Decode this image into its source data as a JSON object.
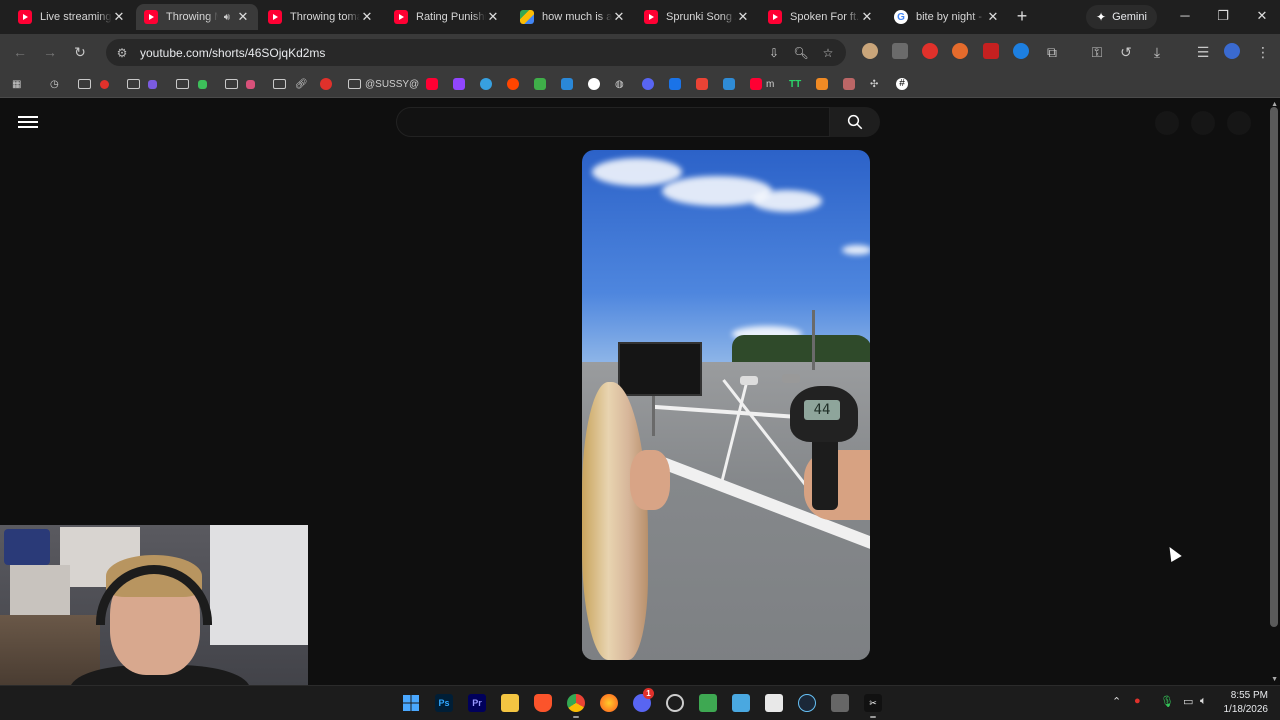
{
  "tabs": [
    {
      "title": "Live streaming",
      "icon": "youtube-icon",
      "active": false
    },
    {
      "title": "Throwing M",
      "icon": "youtube-icon",
      "active": true
    },
    {
      "title": "Throwing toma",
      "icon": "youtube-icon",
      "active": false
    },
    {
      "title": "Rating Punishin",
      "icon": "youtube-icon",
      "active": false
    },
    {
      "title": "how much is a l",
      "icon": "drive-icon",
      "active": false
    },
    {
      "title": "Sprunki Song A",
      "icon": "youtube-icon",
      "active": false
    },
    {
      "title": "Spoken For ft. I",
      "icon": "youtube-icon",
      "active": false
    },
    {
      "title": "bite by night - C",
      "icon": "google-icon",
      "active": false
    }
  ],
  "gemini_label": "Gemini",
  "address_bar": {
    "url": "youtube.com/shorts/46SOjqKd2ms"
  },
  "bookmarks": {
    "sussy_label": "@SUSSY@",
    "m_label": "m",
    "tt_label": "TT"
  },
  "search": {
    "placeholder": ""
  },
  "video": {
    "gun_reading": "44"
  },
  "taskbar": {
    "photoshop": "Ps",
    "premiere": "Pr",
    "discord_badge": "1"
  },
  "clock": {
    "time": "8:55 PM",
    "date": "1/18/2026"
  },
  "colors": {
    "youtube_red": "#ff0033",
    "tab_strip": "#1f1f1f",
    "toolbar": "#3a3a3a",
    "page_bg": "#0f0f0f"
  }
}
